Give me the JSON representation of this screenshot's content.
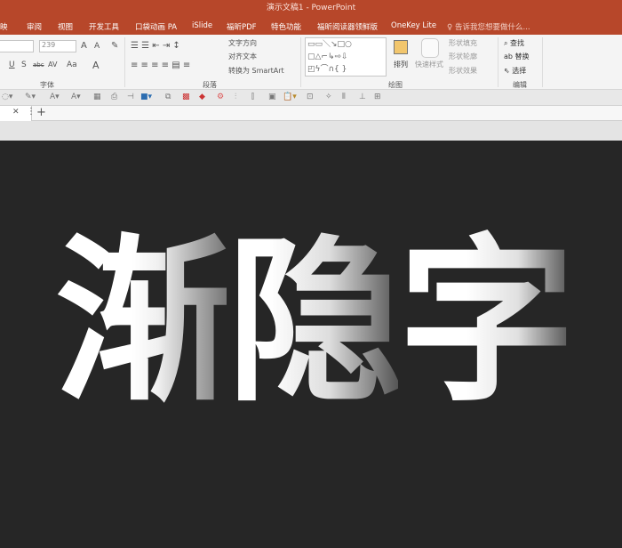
{
  "title": "演示文稿1 - PowerPoint",
  "tabs": [
    "映",
    "审阅",
    "视图",
    "开发工具",
    "口袋动画 PA",
    "iSlide",
    "福昕PDF",
    "特色功能",
    "福昕阅读器领鲜版",
    "OneKey Lite"
  ],
  "tell_me": "告诉我您想要做什么...",
  "font": {
    "size": "239",
    "label": "字体",
    "grow": "A",
    "shrink": "A",
    "underline": "U",
    "shadow": "S",
    "strike": "abc",
    "spacing": "AV",
    "case": "Aa",
    "color": "A"
  },
  "paragraph": {
    "label": "段落",
    "text_direction": "文字方向",
    "align_text": "对齐文本",
    "smartart": "转换为 SmartArt"
  },
  "drawing": {
    "label": "绘图",
    "arrange": "排列",
    "quick_styles": "快速样式",
    "fill": "形状填充",
    "outline": "形状轮廓",
    "effects": "形状效果"
  },
  "editing": {
    "label": "编辑",
    "find": "查找",
    "replace": "替换",
    "select": "选择"
  },
  "tabbar": {
    "close": "✕",
    "add": "+"
  },
  "slide": {
    "chars": [
      "渐",
      "隐",
      "字"
    ]
  }
}
